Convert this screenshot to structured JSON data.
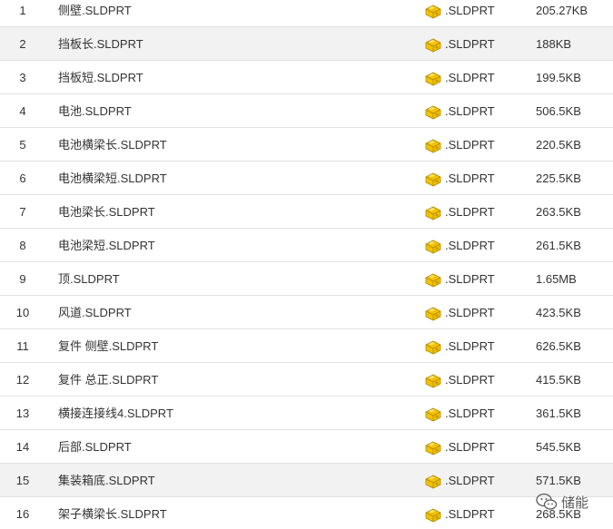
{
  "files": [
    {
      "num": "1",
      "name": "侧壁.SLDPRT",
      "ext": ".SLDPRT",
      "size": "205.27KB",
      "icon": "sldprt-file-icon"
    },
    {
      "num": "2",
      "name": "挡板长.SLDPRT",
      "ext": ".SLDPRT",
      "size": "188KB",
      "icon": "sldprt-file-icon"
    },
    {
      "num": "3",
      "name": "挡板短.SLDPRT",
      "ext": ".SLDPRT",
      "size": "199.5KB",
      "icon": "sldprt-file-icon"
    },
    {
      "num": "4",
      "name": "电池.SLDPRT",
      "ext": ".SLDPRT",
      "size": "506.5KB",
      "icon": "sldprt-file-icon"
    },
    {
      "num": "5",
      "name": "电池横梁长.SLDPRT",
      "ext": ".SLDPRT",
      "size": "220.5KB",
      "icon": "sldprt-file-icon"
    },
    {
      "num": "6",
      "name": "电池横梁短.SLDPRT",
      "ext": ".SLDPRT",
      "size": "225.5KB",
      "icon": "sldprt-file-icon"
    },
    {
      "num": "7",
      "name": "电池梁长.SLDPRT",
      "ext": ".SLDPRT",
      "size": "263.5KB",
      "icon": "sldprt-file-icon"
    },
    {
      "num": "8",
      "name": "电池梁短.SLDPRT",
      "ext": ".SLDPRT",
      "size": "261.5KB",
      "icon": "sldprt-file-icon"
    },
    {
      "num": "9",
      "name": "顶.SLDPRT",
      "ext": ".SLDPRT",
      "size": "1.65MB",
      "icon": "sldprt-file-icon"
    },
    {
      "num": "10",
      "name": "风道.SLDPRT",
      "ext": ".SLDPRT",
      "size": "423.5KB",
      "icon": "sldprt-file-icon"
    },
    {
      "num": "11",
      "name": "复件 侧壁.SLDPRT",
      "ext": ".SLDPRT",
      "size": "626.5KB",
      "icon": "sldprt-file-icon"
    },
    {
      "num": "12",
      "name": "复件 总正.SLDPRT",
      "ext": ".SLDPRT",
      "size": "415.5KB",
      "icon": "sldprt-file-icon"
    },
    {
      "num": "13",
      "name": "横接连接线4.SLDPRT",
      "ext": ".SLDPRT",
      "size": "361.5KB",
      "icon": "sldprt-file-icon"
    },
    {
      "num": "14",
      "name": "后部.SLDPRT",
      "ext": ".SLDPRT",
      "size": "545.5KB",
      "icon": "sldprt-file-icon"
    },
    {
      "num": "15",
      "name": "集装箱底.SLDPRT",
      "ext": ".SLDPRT",
      "size": "571.5KB",
      "icon": "sldprt-file-icon"
    },
    {
      "num": "16",
      "name": "架子横梁长.SLDPRT",
      "ext": ".SLDPRT",
      "size": "268.5KB",
      "icon": "sldprt-file-icon"
    }
  ],
  "highlighted_rows": [
    "2",
    "15"
  ],
  "watermark": {
    "text": "储能",
    "icon": "wechat-icon"
  },
  "colors": {
    "row_highlight": "#f2f2f2",
    "row_border": "#e2e2e2",
    "icon_gold": "#f2c200",
    "text": "#333333"
  }
}
